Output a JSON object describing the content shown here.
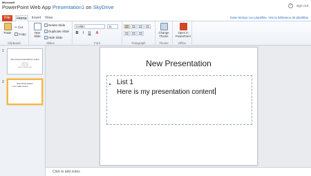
{
  "titlebar": {
    "brand": "Microsoft",
    "app_name": "PowerPoint Web App",
    "doc_name": "Presentation1",
    "on_word": "on",
    "location": "SkyDrive",
    "signout": "sign out",
    "help_glyph": "?"
  },
  "tabs": [
    {
      "label": "File"
    },
    {
      "label": "Home"
    },
    {
      "label": "Insert"
    },
    {
      "label": "View"
    }
  ],
  "promo_text": "Gane tiempo con plantillas. Vea la biblioteca de plantillas",
  "ribbon": {
    "clipboard": {
      "paste": "Paste",
      "cut": "Cut",
      "copy": "Copy",
      "label": "Clipboard"
    },
    "slides": {
      "new_slide": "New Slide",
      "delete": "Delete Slide",
      "duplicate": "Duplicate Slide",
      "hide": "Hide Slide",
      "label": "Slides"
    },
    "font": {
      "family": "Calibri",
      "size": "11",
      "bold": "B",
      "italic": "I",
      "underline": "U",
      "color_glyph": "A",
      "label": "Font"
    },
    "paragraph": {
      "label": "Paragraph"
    },
    "theme": {
      "change": "Change Theme",
      "label": "Theme"
    },
    "office": {
      "open": "Open in PowerPoint",
      "label": "Office"
    }
  },
  "slides_panel": [
    {
      "number": "1",
      "title": "Mi primera presentación online",
      "subtitle_lines": [
        "sub text",
        "more text",
        "more subtext text"
      ]
    },
    {
      "number": "2",
      "title": "New Presentation",
      "bullet": "• List 1 slide content"
    }
  ],
  "slide": {
    "title": "New Presentation",
    "lines": [
      "List 1",
      "Here is my presentation content"
    ]
  },
  "notes": {
    "placeholder": "Click to add notes"
  },
  "colors": {
    "file_tab": "#d24726",
    "link": "#2b6cbf",
    "selected_thumb": "#f2b84b",
    "theme_icon": "#c8d6ea",
    "office_icon": "#d24726",
    "paste_icon": "#e9c46a"
  }
}
